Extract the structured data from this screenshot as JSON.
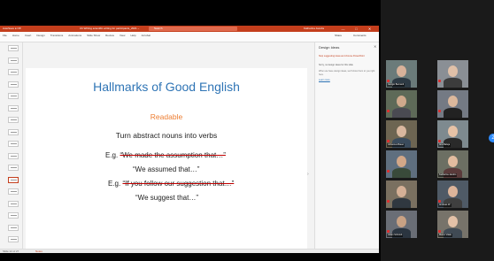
{
  "titlebar": {
    "autosave": "AutoSave ● Off",
    "document": "Ch Writing scientific writing for participants_2021 ~",
    "search": "Search",
    "user": "Katharina Jacobs",
    "minimize": "—",
    "maximize": "□",
    "close": "✕"
  },
  "ribbon": {
    "tabs": [
      "File",
      "Home",
      "Insert",
      "Design",
      "Transitions",
      "Animations",
      "Slide Show",
      "Review",
      "View",
      "Help",
      "Acrobat"
    ],
    "share": "Share",
    "comments": "Comments"
  },
  "thumbnails": {
    "count": 17,
    "selected_index": 11
  },
  "slide": {
    "title": "Hallmarks of Good English",
    "subtitle": "Readable",
    "instruction": "Turn abstract nouns into verbs",
    "example1_prefix": "E.g. ",
    "example1_struck": "“We made the assumption that…”",
    "answer1": "“We assumed that…”",
    "example2_prefix": "E.g. ",
    "example2_struck": "“If you follow our suggestion that…”",
    "answer2": "“We suggest that…”",
    "accent_color": "#ed7d31",
    "title_color": "#2e74b5"
  },
  "design_ideas": {
    "title": "Design Ideas",
    "close": "✕",
    "line1": "Stop suggesting ideas and choose PowerPoint",
    "line2": "Sorry, no design ideas for this slide",
    "line3": "When we have design ideas, we'll show them to you right here.",
    "link": "Learn more"
  },
  "statusbar": {
    "slide_info": "Slide 12 of 27",
    "notes": "Notes"
  },
  "nav": {
    "next_slide": "›"
  },
  "participants": [
    {
      "name": "Giorgio Bernardi",
      "muted": true
    },
    {
      "name": "",
      "muted": true
    },
    {
      "name": "",
      "muted": true
    },
    {
      "name": "",
      "muted": true
    },
    {
      "name": "Johannes Bauer",
      "muted": true
    },
    {
      "name": "Ana Baluja",
      "muted": true
    },
    {
      "name": "",
      "muted": true
    },
    {
      "name": "Katharina Jacobs",
      "muted": false
    },
    {
      "name": "",
      "muted": true
    },
    {
      "name": "Andreas W.",
      "muted": true
    },
    {
      "name": "Julian Schmidt",
      "muted": true
    },
    {
      "name": "Marco Vitale",
      "muted": true
    }
  ],
  "grid_page": "2",
  "colors": {
    "powerpoint_red": "#c43e1c",
    "zoom_blue": "#2d8cff",
    "mute_red": "#e03030"
  }
}
